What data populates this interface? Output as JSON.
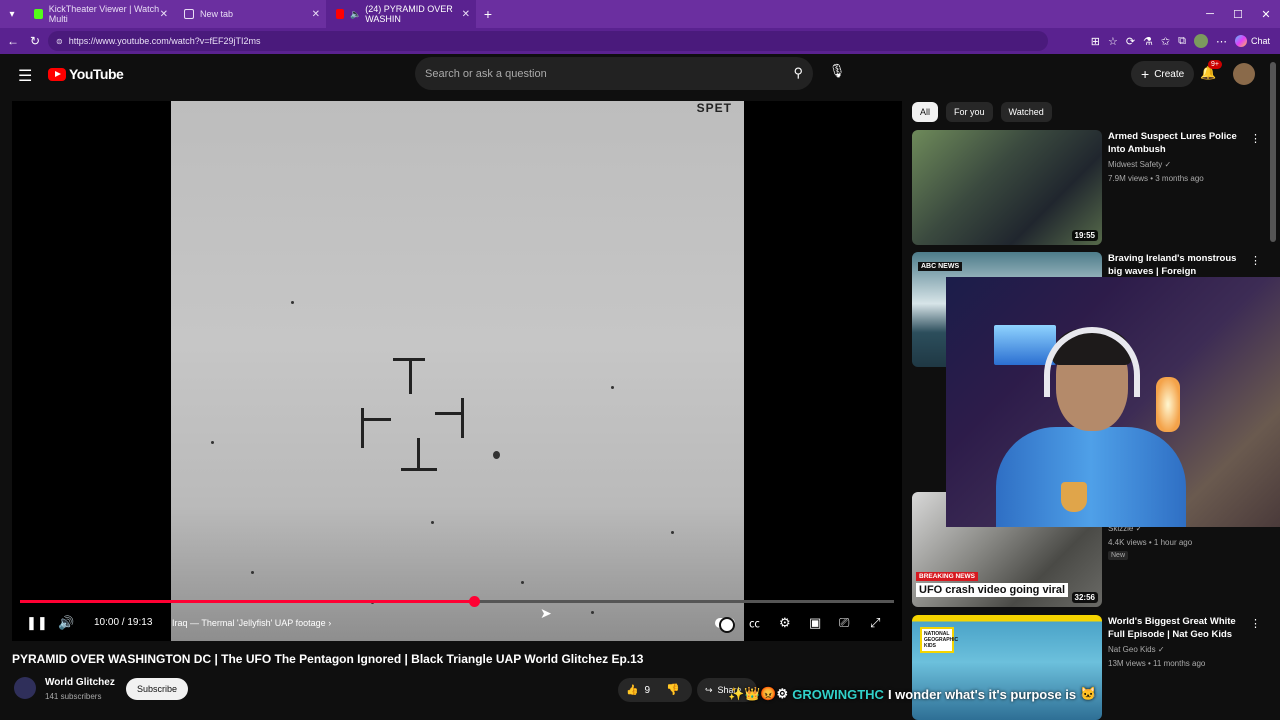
{
  "browser": {
    "tabs": [
      {
        "label": "KickTheater Viewer | Watch Multi",
        "active": false
      },
      {
        "label": "New tab",
        "active": false
      },
      {
        "label": "(24) PYRAMID OVER WASHIN",
        "active": true
      }
    ],
    "url": "https://www.youtube.com/watch?v=fEF29jTI2ms",
    "chat_label": "Chat"
  },
  "youtube": {
    "logo_text": "YouTube",
    "search_placeholder": "Search or ask a question",
    "create_label": "Create",
    "notifications_badge": "9+"
  },
  "player": {
    "time": "10:00 / 19:13",
    "chapter": "Iraq — Thermal 'Jellyfish' UAP footage",
    "progress": 0.52,
    "osd_text": "SPET"
  },
  "video": {
    "title": "PYRAMID OVER WASHINGTON DC | The UFO The Pentagon Ignored | Black Triangle UAP World Glitchez Ep.13",
    "channel": "World Glitchez",
    "subscribers": "141 subscribers",
    "subscribe_label": "Subscribe",
    "likes": "9",
    "share_label": "Share"
  },
  "sidebar": {
    "chips": [
      "All",
      "For you",
      "Watched"
    ],
    "recommendations": [
      {
        "title": "Armed Suspect Lures Police Into Ambush",
        "channel": "Midwest Safety",
        "meta": "7.9M views • 3 months ago",
        "duration": "19:55"
      },
      {
        "title": "Braving Ireland's monstrous big waves | Foreign Correspondent",
        "channel": "",
        "meta": "",
        "duration": "",
        "thumb_label": "ABC NEWS"
      },
      {
        "title": "",
        "channel": "Skizzle",
        "meta": "4.4K views • 1 hour ago",
        "duration": "32:56",
        "badge": "New",
        "breaking": "BREAKING NEWS",
        "caption": "UFO crash video going viral"
      },
      {
        "title": "World's Biggest Great White Full Episode | Nat Geo Kids",
        "channel": "Nat Geo Kids",
        "meta": "13M views • 11 months ago",
        "duration": "",
        "thumb_label": "NATIONAL GEOGRAPHIC KIDS"
      }
    ]
  },
  "stream_chat": {
    "user": "GROWINGTHC",
    "message": "I wonder what's it's purpose is"
  }
}
